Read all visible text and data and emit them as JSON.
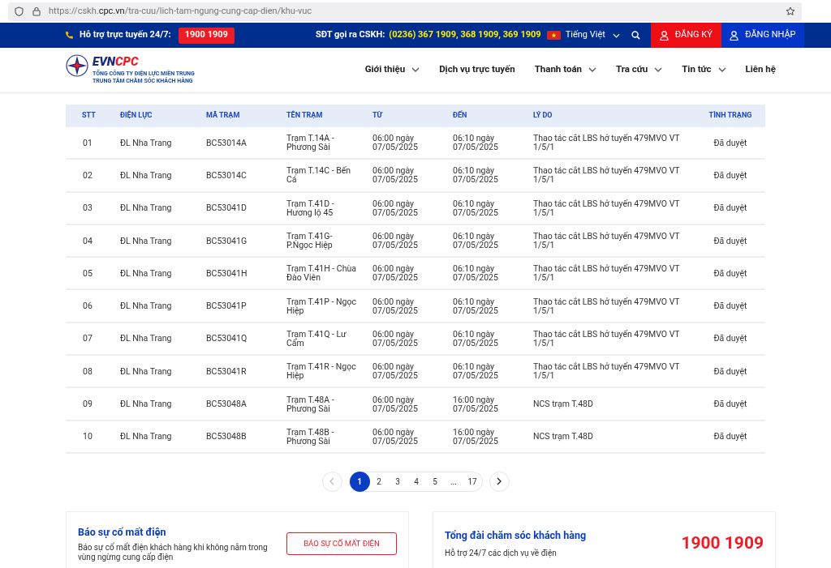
{
  "browser": {
    "url_host": "https://cskh.",
    "url_domain": "cpc.vn",
    "url_path": "/tra-cuu/lich-tam-ngung-cung-cap-dien/khu-vuc"
  },
  "topbar": {
    "support_label": "Hỗ trợ trực tuyến 24/7:",
    "support_phone": "1900 1909",
    "call_label": "SĐT gọi ra CSKH:",
    "call_numbers": "(0236) 367 1909, 368 1909, 369 1909",
    "language": "Tiếng Việt",
    "register": "ĐĂNG KÝ",
    "login": "ĐĂNG NHẬP"
  },
  "logo": {
    "brand_a": "EVN",
    "brand_b": "CPC",
    "line1": "TỔNG CÔNG TY ĐIỆN LỰC MIỀN TRUNG",
    "line2": "TRUNG TÂM CHĂM SÓC KHÁCH HÀNG"
  },
  "nav": [
    {
      "label": "Giới thiệu",
      "dropdown": true
    },
    {
      "label": "Dịch vụ trực tuyến",
      "dropdown": false
    },
    {
      "label": "Thanh toán",
      "dropdown": true
    },
    {
      "label": "Tra cứu",
      "dropdown": true
    },
    {
      "label": "Tin tức",
      "dropdown": true
    },
    {
      "label": "Liên hệ",
      "dropdown": false
    }
  ],
  "table": {
    "columns": [
      "STT",
      "ĐIỆN LỰC",
      "MÃ TRẠM",
      "TÊN TRẠM",
      "TỪ",
      "ĐẾN",
      "LÝ DO",
      "TÌNH TRẠNG"
    ],
    "rows": [
      [
        "01",
        "ĐL Nha Trang",
        "BC53014A",
        "Trạm T.14A - Phương Sài",
        "06:00 ngày 07/05/2025",
        "06:10 ngày 07/05/2025",
        "Thao tác cắt LBS hở tuyến 479MVO VT 1/5/1",
        "Đã duyệt"
      ],
      [
        "02",
        "ĐL Nha Trang",
        "BC53014C",
        "Trạm T.14C - Bến Cá",
        "06:00 ngày 07/05/2025",
        "06:10 ngày 07/05/2025",
        "Thao tác cắt LBS hở tuyến 479MVO VT 1/5/1",
        "Đã duyệt"
      ],
      [
        "03",
        "ĐL Nha Trang",
        "BC53041D",
        "Trạm T.41D - Hương lộ 45",
        "06:00 ngày 07/05/2025",
        "06:10 ngày 07/05/2025",
        "Thao tác cắt LBS hở tuyến 479MVO VT 1/5/1",
        "Đã duyệt"
      ],
      [
        "04",
        "ĐL Nha Trang",
        "BC53041G",
        "Trạm T.41G- P.Ngọc Hiệp",
        "06:00 ngày 07/05/2025",
        "06:10 ngày 07/05/2025",
        "Thao tác cắt LBS hở tuyến 479MVO VT 1/5/1",
        "Đã duyệt"
      ],
      [
        "05",
        "ĐL Nha Trang",
        "BC53041H",
        "Trạm T.41H - Chùa Đào Viên",
        "06:00 ngày 07/05/2025",
        "06:10 ngày 07/05/2025",
        "Thao tác cắt LBS hở tuyến 479MVO VT 1/5/1",
        "Đã duyệt"
      ],
      [
        "06",
        "ĐL Nha Trang",
        "BC53041P",
        "Trạm T.41P - Ngọc Hiệp",
        "06:00 ngày 07/05/2025",
        "06:10 ngày 07/05/2025",
        "Thao tác cắt LBS hở tuyến 479MVO VT 1/5/1",
        "Đã duyệt"
      ],
      [
        "07",
        "ĐL Nha Trang",
        "BC53041Q",
        "Trạm T.41Q - Lư Cấm",
        "06:00 ngày 07/05/2025",
        "06:10 ngày 07/05/2025",
        "Thao tác cắt LBS hở tuyến 479MVO VT 1/5/1",
        "Đã duyệt"
      ],
      [
        "08",
        "ĐL Nha Trang",
        "BC53041R",
        "Trạm T.41R - Ngọc Hiệp",
        "06:00 ngày 07/05/2025",
        "06:10 ngày 07/05/2025",
        "Thao tác cắt LBS hở tuyến 479MVO VT 1/5/1",
        "Đã duyệt"
      ],
      [
        "09",
        "ĐL Nha Trang",
        "BC53048A",
        "Trạm T.48A - Phương Sài",
        "06:00 ngày 07/05/2025",
        "16:00 ngày 07/05/2025",
        "NCS trạm T.48D",
        "Đã duyệt"
      ],
      [
        "10",
        "ĐL Nha Trang",
        "BC53048B",
        "Trạm T.48B - Phương Sài",
        "06:00 ngày 07/05/2025",
        "16:00 ngày 07/05/2025",
        "NCS trạm T.48D",
        "Đã duyệt"
      ]
    ]
  },
  "pagination": {
    "prev_disabled": true,
    "pages": [
      {
        "label": "1",
        "selected": true
      },
      {
        "label": "2",
        "selected": false
      },
      {
        "label": "3",
        "selected": false
      },
      {
        "label": "4",
        "selected": false
      },
      {
        "label": "5",
        "selected": false
      },
      {
        "label": "...",
        "selected": false
      },
      {
        "label": "17",
        "selected": false
      }
    ]
  },
  "report_card": {
    "title": "Báo sự cố mất điện",
    "text": "Báo sự cố mất điện khách hàng khi không nằm trong vùng ngừng cung cấp điện",
    "button": "BÁO SỰ CỐ MẤT ĐIỆN"
  },
  "hotline_card": {
    "title": "Tổng đài chăm sóc khách hàng",
    "text": "Hỗ trợ 24/7 các dịch vụ về điện",
    "phone": "1900 1909"
  }
}
